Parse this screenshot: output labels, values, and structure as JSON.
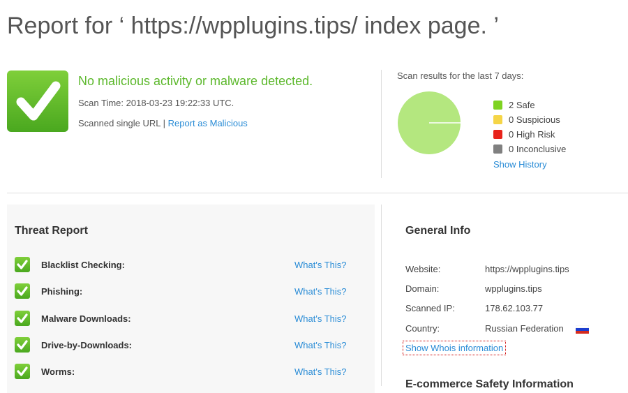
{
  "page_title": "Report for ‘ https://wpplugins.tips/ index page. ’",
  "status": {
    "headline": "No malicious activity or malware detected.",
    "scan_time": "Scan Time: 2018-03-23 19:22:33 UTC.",
    "scanned_prefix": "Scanned single URL | ",
    "report_link": "Report as Malicious"
  },
  "scan_results": {
    "title": "Scan results for the last 7 days:",
    "legend": [
      {
        "label": "2 Safe",
        "color": "#7ed321"
      },
      {
        "label": "0 Suspicious",
        "color": "#f5d547"
      },
      {
        "label": "0 High Risk",
        "color": "#e8231b"
      },
      {
        "label": "0 Inconclusive",
        "color": "#808080"
      }
    ],
    "pie_color": "#b4e77f",
    "show_history": "Show History"
  },
  "threat_report": {
    "title": "Threat Report",
    "whats_this": "What's This?",
    "rows": [
      {
        "label": "Blacklist Checking:"
      },
      {
        "label": "Phishing:"
      },
      {
        "label": "Malware Downloads:"
      },
      {
        "label": "Drive-by-Downloads:"
      },
      {
        "label": "Worms:"
      }
    ]
  },
  "general_info": {
    "title": "General Info",
    "website_key": "Website:",
    "website_val": "https://wpplugins.tips",
    "domain_key": "Domain:",
    "domain_val": "wpplugins.tips",
    "ip_key": "Scanned IP:",
    "ip_val": "178.62.103.77",
    "country_key": "Country:",
    "country_val": "Russian Federation",
    "whois_link": "Show Whois information"
  },
  "ecommerce_title": "E-commerce Safety Information"
}
